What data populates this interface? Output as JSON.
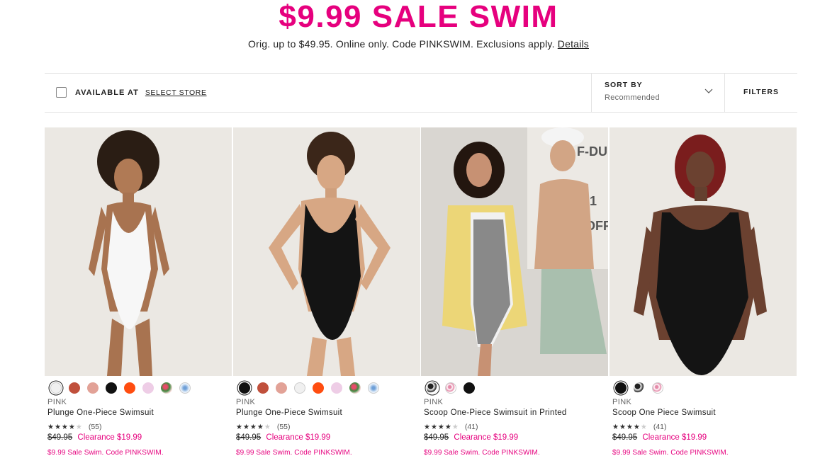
{
  "hero": {
    "title": "$9.99 SALE SWIM",
    "subtitle": "Orig. up to $49.95. Online only. Code PINKSWIM. Exclusions apply.",
    "details_link": "Details"
  },
  "toolbar": {
    "available_at": "AVAILABLE AT",
    "select_store": "SELECT STORE",
    "sort_label": "SORT BY",
    "sort_value": "Recommended",
    "filters": "FILTERS"
  },
  "colors": {
    "accent": "#e6007e"
  },
  "products": [
    {
      "brand": "PINK",
      "name": "Plunge One-Piece Swimsuit",
      "rating": 4,
      "reviews": "(55)",
      "orig_price": "$49.95",
      "sale": "Clearance $19.99",
      "promo": "$9.99 Sale Swim. Code PINKSWIM.",
      "image": "model in white plunge one-piece swimsuit",
      "swatches": [
        "#f0f0f0",
        "#c0503c",
        "#e2a297",
        "#111111",
        "#ff4d10",
        "#eecde6",
        "floral-print",
        "blue-floral-print"
      ]
    },
    {
      "brand": "PINK",
      "name": "Plunge One-Piece Swimsuit",
      "rating": 4,
      "reviews": "(55)",
      "orig_price": "$49.95",
      "sale": "Clearance $19.99",
      "promo": "$9.99 Sale Swim. Code PINKSWIM.",
      "image": "model in black plunge one-piece swimsuit",
      "swatches": [
        "#111111",
        "#c0503c",
        "#e2a297",
        "#f0f0f0",
        "#ff4d10",
        "#eecde6",
        "floral-print",
        "blue-floral-print"
      ]
    },
    {
      "brand": "PINK",
      "name": "Scoop One-Piece Swimsuit in Printed",
      "rating": 4,
      "reviews": "(41)",
      "orig_price": "$49.95",
      "sale": "Clearance $19.99",
      "promo": "$9.99 Sale Swim. Code PINKSWIM.",
      "image": "two models, floral print swimsuit and yellow hoodie",
      "swatches": [
        "black-white-print",
        "pink-dot-print",
        "#111111"
      ]
    },
    {
      "brand": "PINK",
      "name": "Scoop One Piece Swimsuit",
      "rating": 4,
      "reviews": "(41)",
      "orig_price": "$49.95",
      "sale": "Clearance $19.99",
      "promo": "$9.99 Sale Swim. Code PINKSWIM.",
      "image": "model in black scoop one-piece swimsuit",
      "swatches": [
        "#111111",
        "black-white-print",
        "pink-dot-print"
      ]
    }
  ]
}
